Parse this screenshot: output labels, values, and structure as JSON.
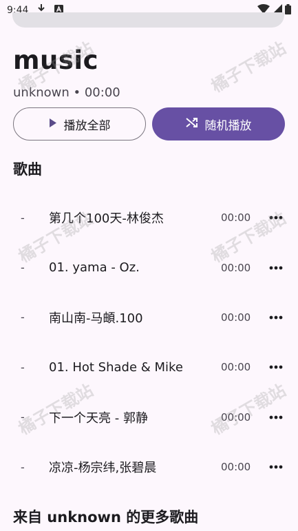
{
  "status_bar": {
    "time": "9:44"
  },
  "album": {
    "title": "music",
    "meta": "unknown • 00:00"
  },
  "actions": {
    "play_all_label": "播放全部",
    "shuffle_label": "随机播放"
  },
  "sections": {
    "songs_title": "歌曲",
    "more_from_title": "来自 unknown 的更多歌曲"
  },
  "songs": [
    {
      "number": "-",
      "title": "第几个100天-林俊杰",
      "duration": "00:00"
    },
    {
      "number": "-",
      "title": "01. yama - Oz.",
      "duration": "00:00"
    },
    {
      "number": "-",
      "title": "南山南-马頔.100",
      "duration": "00:00"
    },
    {
      "number": "-",
      "title": "01. Hot Shade & Mike",
      "duration": "00:00"
    },
    {
      "number": "-",
      "title": "下一个天亮 - 郭静",
      "duration": "00:00"
    },
    {
      "number": "-",
      "title": "凉凉-杨宗纬,张碧晨",
      "duration": "00:00"
    }
  ],
  "watermark": "橘子下载站",
  "colors": {
    "background": "#fdf7fd",
    "accent": "#6750a4",
    "outline": "#79747e"
  },
  "icons": {
    "download": "download-icon",
    "keyboard": "keyboard-icon",
    "wifi": "wifi-icon",
    "signal": "signal-icon",
    "battery": "battery-icon",
    "play": "play-icon",
    "shuffle": "shuffle-icon",
    "more": "more-horiz-icon"
  }
}
